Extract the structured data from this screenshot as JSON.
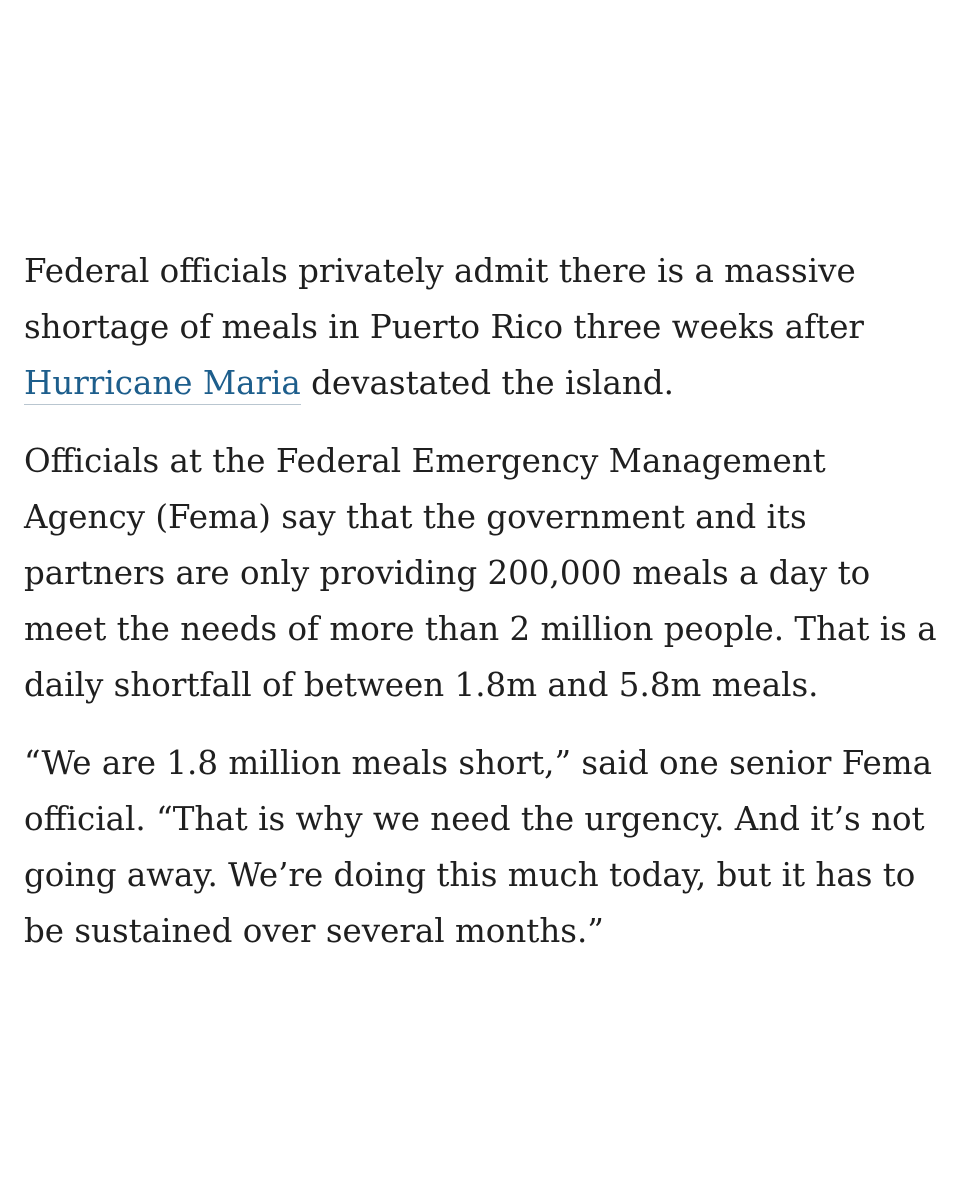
{
  "article": {
    "paragraphs": [
      {
        "lines": [
          "Federal officials privately admit there is a massive",
          "shortage of meals in Puerto Rico three weeks after"
        ],
        "link_text": "Hurricane Maria",
        "after_link": " devastated the island."
      },
      {
        "lines": [
          "Officials at the Federal Emergency Management",
          "Agency (Fema) say that the government and its",
          "partners are only providing 200,000 meals a day to",
          "meet the needs of more than 2 million people. That is a",
          "daily shortfall of between 1.8m and 5.8m meals."
        ]
      },
      {
        "lines": [
          "“We are 1.8 million meals short,” said one senior Fema",
          "official. “That is why we need the urgency. And it’s not",
          "going away. We’re doing this much today, but it has to",
          "be sustained over several months.”"
        ]
      }
    ],
    "colors": {
      "text": "#1f1f1f",
      "link": "#1d5e8c",
      "background": "#ffffff"
    }
  }
}
